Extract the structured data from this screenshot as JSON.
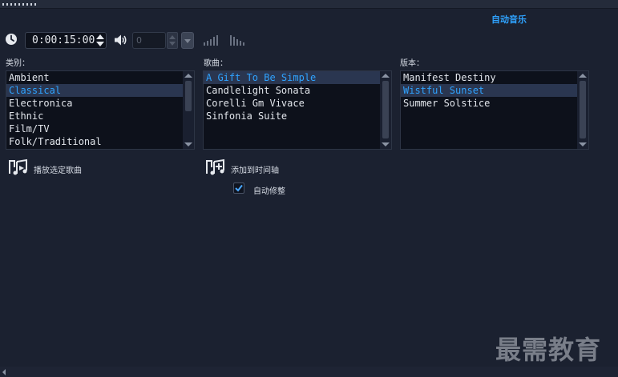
{
  "panel": {
    "title": "自动音乐"
  },
  "playback": {
    "timecode": "0:00:15:00",
    "volume_value": "0"
  },
  "categories": {
    "label": "类别：",
    "items": [
      "Ambient",
      "Classical",
      "Electronica",
      "Ethnic",
      "Film/TV",
      "Folk/Traditional"
    ],
    "selected": "Classical"
  },
  "songs": {
    "label": "歌曲：",
    "items": [
      "A Gift To Be Simple",
      "Candlelight Sonata",
      "Corelli Gm Vivace",
      "Sinfonia Suite"
    ],
    "selected": "A Gift To Be Simple"
  },
  "versions": {
    "label": "版本：",
    "items": [
      "Manifest Destiny",
      "Wistful Sunset",
      "Summer Solstice"
    ],
    "selected": "Wistful Sunset"
  },
  "actions": {
    "play_selected": "播放选定歌曲",
    "add_to_timeline": "添加到时间轴",
    "auto_trim": "自动修整",
    "auto_trim_checked": true
  },
  "watermark": "最需教育",
  "colors": {
    "background": "#1b2130",
    "accent": "#2fa3ff",
    "list_bg": "#0d111b",
    "selection_bg": "#2a3650"
  }
}
